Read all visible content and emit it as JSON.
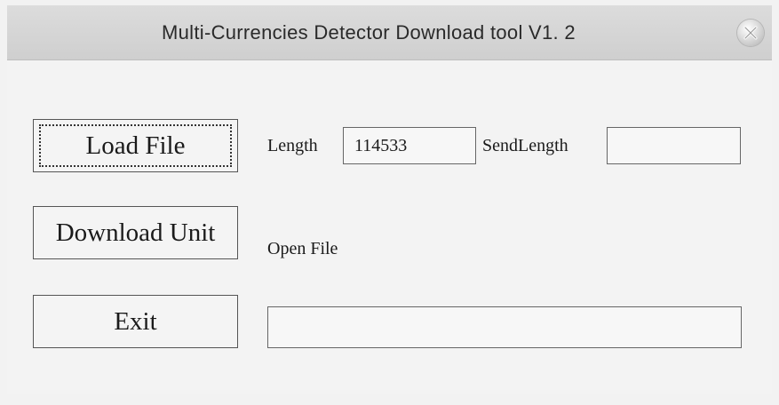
{
  "window": {
    "title": "Multi-Currencies Detector Download tool V1. 2",
    "close_icon": "close-x-icon"
  },
  "buttons": {
    "load_file": "Load File",
    "download_unit": "Download Unit",
    "exit": "Exit"
  },
  "fields": {
    "length_label": "Length",
    "length_value": "114533",
    "sendlength_label": "SendLength",
    "sendlength_value": "",
    "status_label": "Open File",
    "file_path_value": ""
  }
}
